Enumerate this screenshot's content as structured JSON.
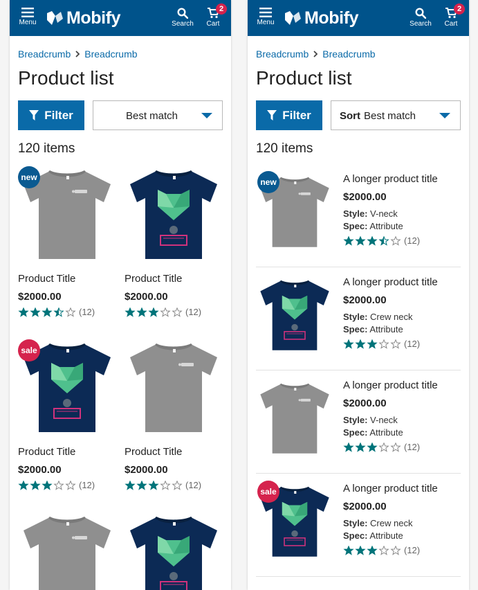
{
  "header": {
    "menu_label": "Menu",
    "logo_text": "Mobify",
    "search_label": "Search",
    "cart_label": "Cart",
    "cart_count": "2",
    "brand_color": "#00538b",
    "badge_color": "#d5234d"
  },
  "breadcrumb": [
    "Breadcrumb",
    "Breadcrumb"
  ],
  "page_title": "Product list",
  "filter_label": "Filter",
  "sort": {
    "label": "Sort",
    "value": "Best match"
  },
  "item_count": "120 items",
  "grid_products": [
    {
      "title": "Product Title",
      "price": "$2000.00",
      "rating": 3.5,
      "reviews": "(12)",
      "tag": "new",
      "shirt": "gray"
    },
    {
      "title": "Product Title",
      "price": "$2000.00",
      "rating": 3,
      "reviews": "(12)",
      "tag": "",
      "shirt": "navy"
    },
    {
      "title": "Product Title",
      "price": "$2000.00",
      "rating": 3,
      "reviews": "(12)",
      "tag": "sale",
      "shirt": "navy"
    },
    {
      "title": "Product Title",
      "price": "$2000.00",
      "rating": 3,
      "reviews": "(12)",
      "tag": "",
      "shirt": "gray"
    },
    {
      "title": "",
      "price": "",
      "rating": 0,
      "reviews": "",
      "tag": "",
      "shirt": "gray"
    },
    {
      "title": "",
      "price": "",
      "rating": 0,
      "reviews": "",
      "tag": "",
      "shirt": "navy"
    }
  ],
  "list_products": [
    {
      "title": "A longer product title",
      "price": "$2000.00",
      "style_label": "Style:",
      "style": "V-neck",
      "spec_label": "Spec:",
      "spec": "Attribute",
      "rating": 3.5,
      "reviews": "(12)",
      "tag": "new",
      "shirt": "gray"
    },
    {
      "title": "A longer product title",
      "price": "$2000.00",
      "style_label": "Style:",
      "style": "Crew neck",
      "spec_label": "Spec:",
      "spec": "Attribute",
      "rating": 3,
      "reviews": "(12)",
      "tag": "",
      "shirt": "navy"
    },
    {
      "title": "A longer product title",
      "price": "$2000.00",
      "style_label": "Style:",
      "style": "V-neck",
      "spec_label": "Spec:",
      "spec": "Attribute",
      "rating": 3,
      "reviews": "(12)",
      "tag": "",
      "shirt": "gray"
    },
    {
      "title": "A longer product title",
      "price": "$2000.00",
      "style_label": "Style:",
      "style": "Crew neck",
      "spec_label": "Spec:",
      "spec": "Attribute",
      "rating": 3,
      "reviews": "(12)",
      "tag": "sale",
      "shirt": "navy"
    }
  ],
  "tags": {
    "new": "new",
    "sale": "sale"
  },
  "colors": {
    "accent": "#0a6aa8",
    "star": "#00747a",
    "new_tag": "#0a5a91",
    "sale_tag": "#d5234d"
  }
}
